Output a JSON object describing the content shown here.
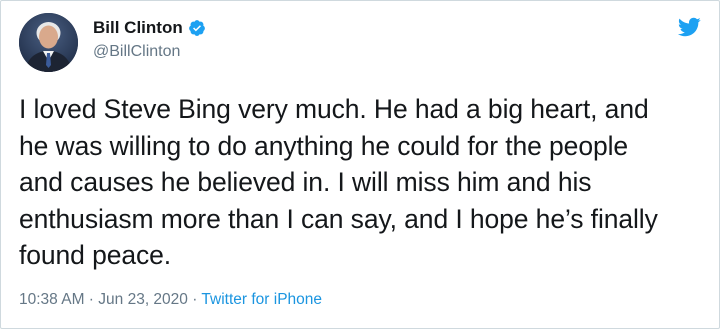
{
  "author": {
    "display_name": "Bill Clinton",
    "handle": "@BillClinton",
    "verified": true
  },
  "tweet": {
    "text": "I loved Steve Bing very much. He had a big heart, and\nhe was willing to do anything he could for the people\nand causes he believed in. I will miss him and his\nenthusiasm more than I can say, and I hope he’s finally\nfound peace."
  },
  "meta": {
    "time": "10:38 AM",
    "separator_1": " · ",
    "date": "Jun 23, 2020",
    "separator_2": " · ",
    "source": "Twitter for iPhone"
  },
  "icons": {
    "verified": "verified-badge-icon",
    "logo": "twitter-bird-icon"
  },
  "colors": {
    "text": "#14171a",
    "secondary": "#657786",
    "link": "#1b95e0",
    "verified": "#1da1f2",
    "logo": "#1da1f2"
  }
}
